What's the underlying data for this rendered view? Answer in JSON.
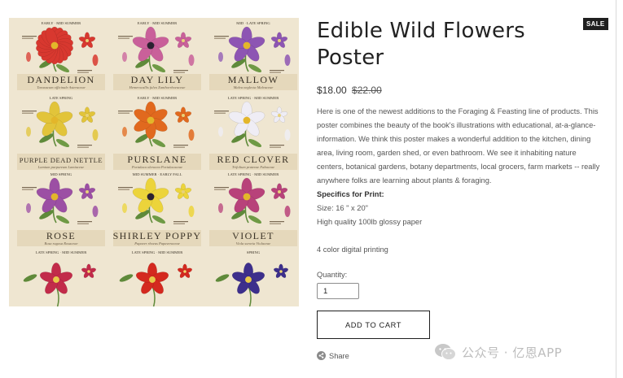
{
  "product": {
    "title_line1": "Edible Wild Flowers",
    "title_line2": "Poster",
    "badge": "SALE",
    "price_current": "$18.00",
    "price_original": "$22.00",
    "description": "Here is one of the newest additions to the Foraging & Feasting line of products. This poster combines the beauty of the book's illustrations with educational, at-a-glance-information. We think this poster makes a wonderful addition to the kitchen, dining area, living room, garden shed, or even bathroom. We see it inhabiting nature centers, botanical gardens, botany departments, local grocers, farm markets -- really anywhere folks are learning about plants & foraging.",
    "specs_heading": "Specifics for Print:",
    "spec_size": "Size: 16 \" x 20\"",
    "spec_paper": "High quality 100lb glossy paper",
    "spec_printing": "4 color digital printing",
    "quantity_label": "Quantity:",
    "quantity_value": "1",
    "add_to_cart": "ADD TO CART",
    "share": "Share"
  },
  "poster": {
    "flowers": [
      {
        "name": "DANDELION",
        "latin": "Taraxacum officinale  Asteraceae",
        "season": "EARLY · MID SUMMER",
        "color": "#d8382f"
      },
      {
        "name": "DAY LILY",
        "latin": "Hemerocallis fulva  Xanthorrhoeaceae",
        "season": "EARLY · MID SUMMER",
        "color": "#c9609a"
      },
      {
        "name": "MALLOW",
        "latin": "Malva neglecta  Malvaceae",
        "season": "MID · LATE SPRING",
        "color": "#8d55b3"
      },
      {
        "name": "PURPLE DEAD NETTLE",
        "latin": "Lamium purpureum  Lamiaceae",
        "season": "LATE SPRING",
        "color": "#e2c43a"
      },
      {
        "name": "PURSLANE",
        "latin": "Portulaca oleracea  Portulacaceae",
        "season": "EARLY · MID SUMMER",
        "color": "#e1691e"
      },
      {
        "name": "RED CLOVER",
        "latin": "Trifolium pratense  Fabaceae",
        "season": "LATE SPRING · MID SUMMER",
        "color": "#efedf5"
      },
      {
        "name": "ROSE",
        "latin": "Rosa rugosa  Rosaceae",
        "season": "MID SPRING",
        "color": "#9c4fa4"
      },
      {
        "name": "SHIRLEY POPPY",
        "latin": "Papaver rhoeas  Papaveraceae",
        "season": "MID SUMMER · EARLY FALL",
        "color": "#ecd43b"
      },
      {
        "name": "VIOLET",
        "latin": "Viola sororia  Violaceae",
        "season": "LATE SPRING · MID SUMMER",
        "color": "#b8427a"
      }
    ],
    "bottom_seasons": [
      "LATE SPRING · MID SUMMER",
      "LATE SPRING · MID SUMMER",
      "SPRING"
    ],
    "bottom_colors": [
      "#c22b4a",
      "#d4291f",
      "#3d2f8c"
    ]
  },
  "watermark": {
    "text": "公众号 · 亿恩APP"
  }
}
